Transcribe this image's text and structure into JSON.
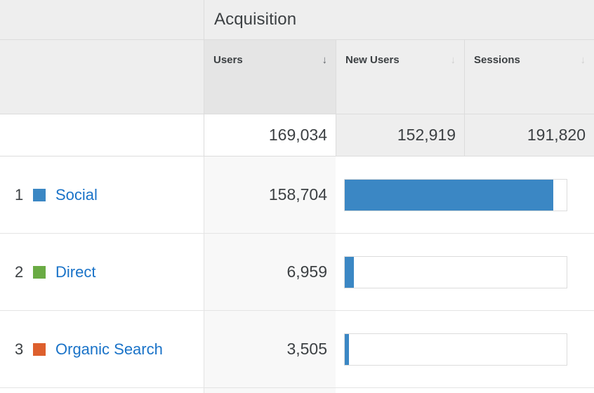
{
  "header": {
    "group_title": "Acquisition",
    "dimension_header": "",
    "columns": [
      {
        "label": "Users",
        "sort_icon": "sort-descending-arrow-icon",
        "sorted": true,
        "arrow": "↓"
      },
      {
        "label": "New Users",
        "sort_icon": "sort-descending-arrow-icon",
        "sorted": false,
        "arrow": "↓"
      },
      {
        "label": "Sessions",
        "sort_icon": "sort-descending-arrow-icon",
        "sorted": false,
        "arrow": "↓"
      }
    ]
  },
  "totals": {
    "users": "169,034",
    "new_users": "152,919",
    "sessions": "191,820"
  },
  "rows": [
    {
      "rank": "1",
      "label": "Social",
      "swatch_color": "#3b87c4",
      "users": "158,704",
      "bar_percent": 94
    },
    {
      "rank": "2",
      "label": "Direct",
      "swatch_color": "#6aab44",
      "users": "6,959",
      "bar_percent": 4
    },
    {
      "rank": "3",
      "label": "Organic Search",
      "swatch_color": "#dd5f2d",
      "users": "3,505",
      "bar_percent": 2
    }
  ],
  "chart_data": {
    "type": "bar",
    "title": "Acquisition",
    "categories": [
      "Social",
      "Direct",
      "Organic Search"
    ],
    "series": [
      {
        "name": "Users",
        "values": [
          158704,
          6959,
          3505
        ]
      },
      {
        "name": "New Users",
        "values": []
      },
      {
        "name": "Sessions",
        "values": []
      }
    ],
    "totals": {
      "Users": 169034,
      "New Users": 152919,
      "Sessions": 191820
    },
    "bar_percent": [
      94,
      4,
      2
    ],
    "xlabel": "",
    "ylabel": "Users",
    "xlim": [
      0,
      169034
    ],
    "grid": false,
    "legend": "none",
    "sorted_by": "Users",
    "sort_direction": "descending",
    "colors": [
      "#3b87c4",
      "#6aab44",
      "#dd5f2d"
    ]
  },
  "theme": {
    "link_color": "#1a73c8",
    "bar_color": "#3b87c4",
    "header_bg": "#eeeeee",
    "sorted_col_bg": "#e5e5e5",
    "border_color": "#dcdcdc"
  }
}
